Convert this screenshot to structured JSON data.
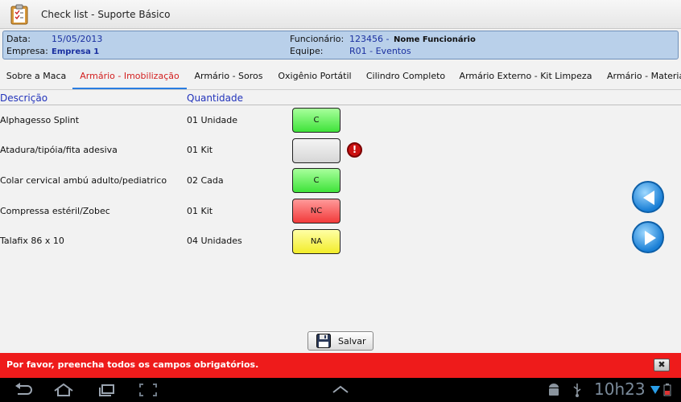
{
  "window": {
    "title": "Check list - Suporte Básico",
    "icon": "clipboard-checklist-icon"
  },
  "header": {
    "data_label": "Data:",
    "data_value": "15/05/2013",
    "empresa_label": "Empresa:",
    "empresa_value": "Empresa 1",
    "funcionario_label": "Funcionário:",
    "funcionario_id": "123456 -",
    "funcionario_nome": "Nome Funcionário",
    "equipe_label": "Equipe:",
    "equipe_value": "R01 - Eventos"
  },
  "tabs": [
    {
      "label": "Sobre a Maca",
      "active": false
    },
    {
      "label": "Armário - Imobilização",
      "active": true
    },
    {
      "label": "Armário - Soros",
      "active": false
    },
    {
      "label": "Oxigênio Portátil",
      "active": false
    },
    {
      "label": "Cilindro Completo",
      "active": false
    },
    {
      "label": "Armário Externo - Kit Limpeza",
      "active": false
    },
    {
      "label": "Armário - Materia",
      "active": false
    }
  ],
  "columns": {
    "descricao": "Descrição",
    "quantidade": "Quantidade"
  },
  "items": [
    {
      "descricao": "Alphagesso Splint",
      "quantidade": "01 Unidade",
      "status": "C",
      "status_color": "#3fe33a"
    },
    {
      "descricao": "Atadura/tipóia/fita adesiva",
      "quantidade": "01 Kit",
      "status": "",
      "status_color": "#d6d6d6",
      "alert": "!"
    },
    {
      "descricao": "Colar cervical ambú adulto/pediatrico",
      "quantidade": "02 Cada",
      "status": "C",
      "status_color": "#3fe33a"
    },
    {
      "descricao": "Compressa estéril/Zobec",
      "quantidade": "01 Kit",
      "status": "NC",
      "status_color": "#f23a3a"
    },
    {
      "descricao": "Talafix 86 x 10",
      "quantidade": "04 Unidades",
      "status": "NA",
      "status_color": "#f2ec2a"
    }
  ],
  "save_button": {
    "label": "Salvar",
    "icon": "floppy-disk-icon"
  },
  "error": {
    "message": "Por favor, preencha todos os campos obrigatórios.",
    "close_icon": "close-icon"
  },
  "system_bar": {
    "time": "10h23"
  },
  "colors": {
    "accent": "#2a7de1",
    "error": "#ee1b1b",
    "header_bg": "#b9d0ea",
    "active_tab": "#d32020"
  }
}
